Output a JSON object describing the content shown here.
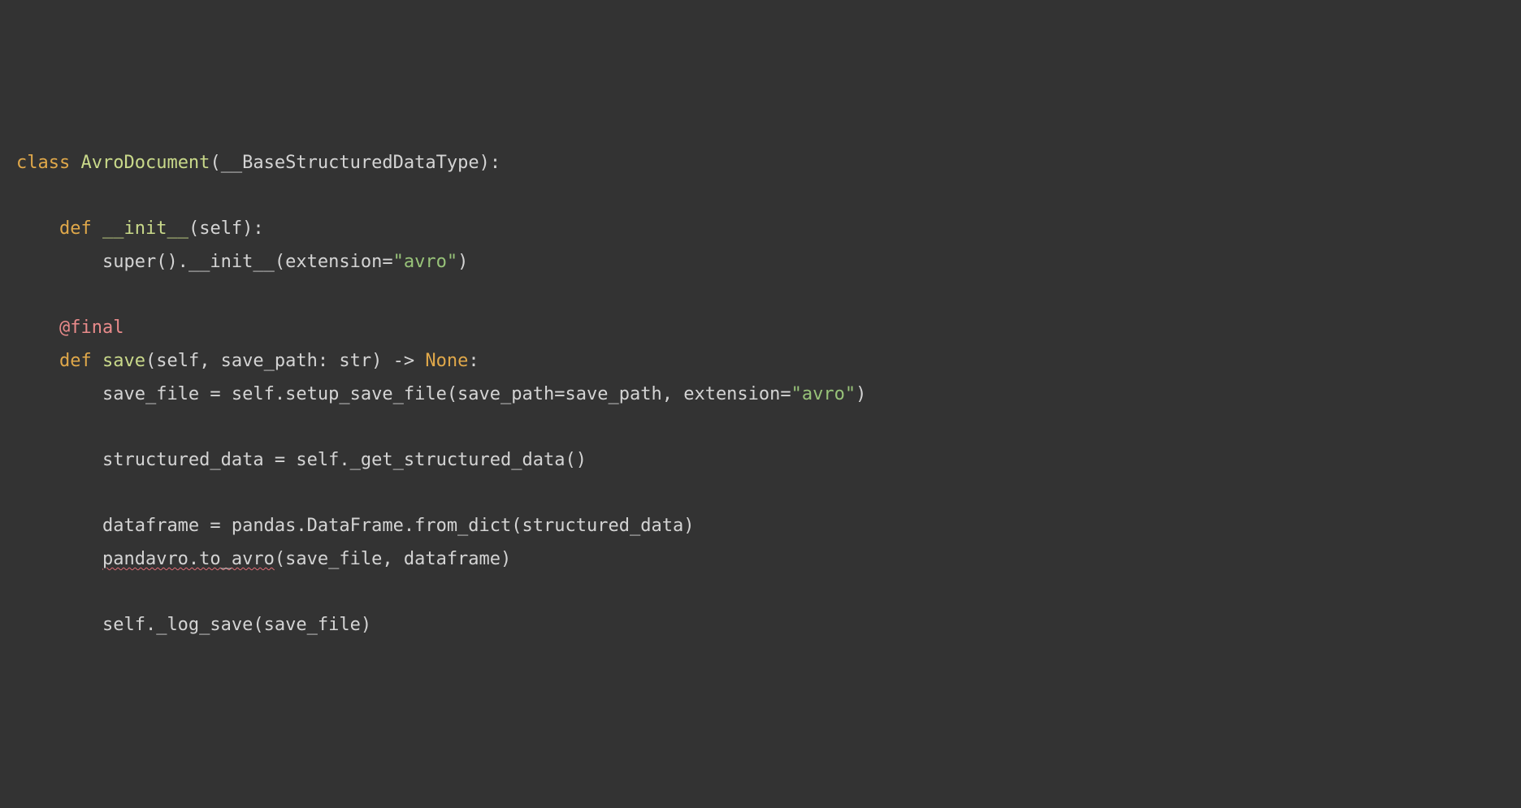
{
  "code": {
    "line1": {
      "kw_class": "class",
      "class_name": "AvroDocument",
      "base": "__BaseStructuredDataType"
    },
    "line3": {
      "kw_def": "def",
      "fn": "__init__",
      "params": "(self):"
    },
    "line4": {
      "call_prefix": "super().",
      "call_fn": "__init__",
      "arg_key": "extension=",
      "arg_val": "\"avro\""
    },
    "line6": {
      "decorator": "@final"
    },
    "line7": {
      "kw_def": "def",
      "fn": "save",
      "params": "(self, save_path: str) -> ",
      "ret": "None",
      "tail": ":"
    },
    "line8": {
      "lhs": "save_file = self.setup_save_file(save_path=save_path, extension=",
      "str": "\"avro\"",
      "rhs": ")"
    },
    "line10": "structured_data = self._get_structured_data()",
    "line12": "dataframe = pandas.DataFrame.from_dict(structured_data)",
    "line13": {
      "squiggle": "pandavro.to_avro",
      "rest": "(save_file, dataframe)"
    },
    "line15": "self._log_save(save_file)"
  },
  "source_code_plain": "class AvroDocument(__BaseStructuredDataType):\n\n    def __init__(self):\n        super().__init__(extension=\"avro\")\n\n    @final\n    def save(self, save_path: str) -> None:\n        save_file = self.setup_save_file(save_path=save_path, extension=\"avro\")\n\n        structured_data = self._get_structured_data()\n\n        dataframe = pandas.DataFrame.from_dict(structured_data)\n        pandavro.to_avro(save_file, dataframe)\n\n        self._log_save(save_file)"
}
